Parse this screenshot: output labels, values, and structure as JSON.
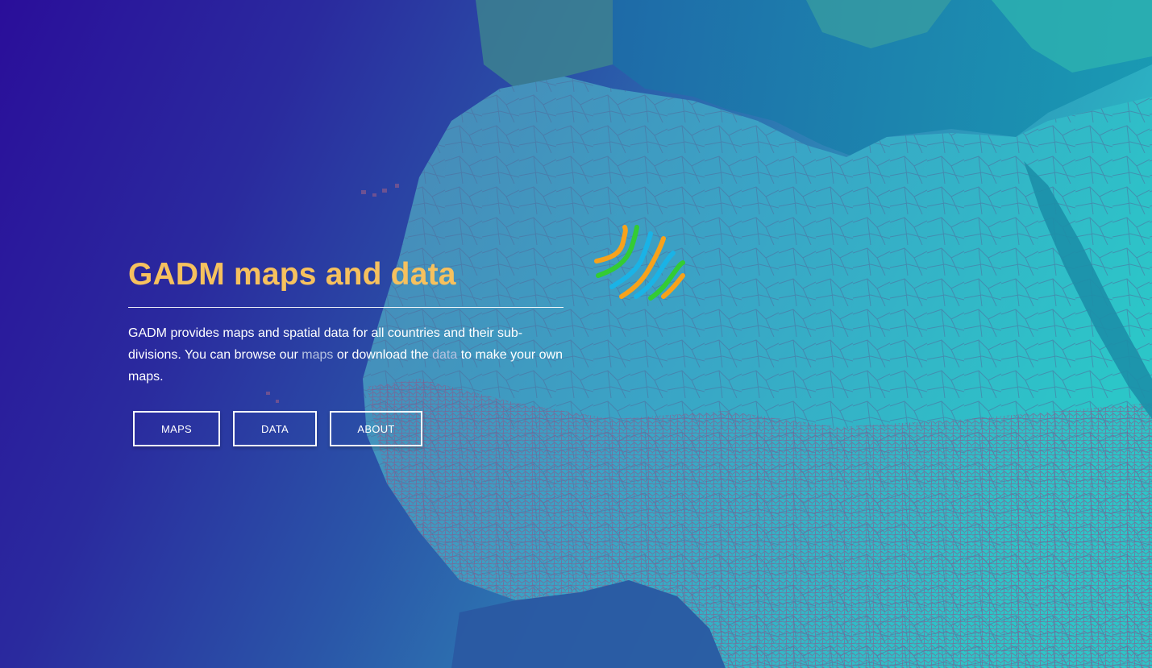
{
  "hero": {
    "title": "GADM maps and data",
    "desc_part1": "GADM provides maps and spatial data for all countries and their sub-divisions. You can browse our ",
    "link_maps": "maps",
    "desc_part2": " or download the ",
    "link_data": "data",
    "desc_part3": " to make your own maps."
  },
  "buttons": {
    "maps": "MAPS",
    "data": "DATA",
    "about": "ABOUT"
  },
  "logo": {
    "name": "gadm-logo",
    "colors": [
      "#f7a21b",
      "#33cc33",
      "#1ab3e6"
    ]
  },
  "colors": {
    "title": "#f6c15e",
    "link": "#b5c2e0",
    "text": "#ffffff"
  }
}
